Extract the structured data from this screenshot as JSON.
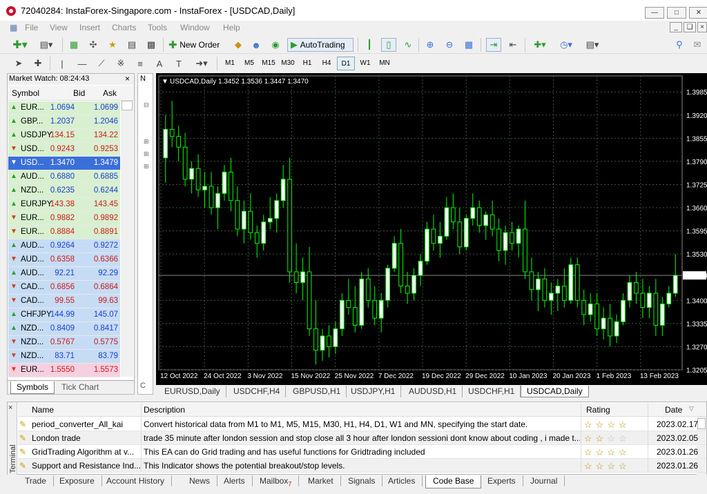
{
  "window": {
    "title": "72040284: InstaForex-Singapore.com - InstaForex - [USDCAD,Daily]"
  },
  "menu": [
    "File",
    "View",
    "Insert",
    "Charts",
    "Tools",
    "Window",
    "Help"
  ],
  "toolbar": {
    "new_order": "New Order",
    "autotrading": "AutoTrading"
  },
  "timeframes": [
    "M1",
    "M5",
    "M15",
    "M30",
    "H1",
    "H4",
    "D1",
    "W1",
    "MN"
  ],
  "active_timeframe": "D1",
  "market_watch": {
    "header": "Market Watch: 08:24:43",
    "cols": {
      "symbol": "Symbol",
      "bid": "Bid",
      "ask": "Ask"
    },
    "rows": [
      {
        "symbol": "EUR...",
        "bid": "1.0694",
        "ask": "1.0699",
        "dir": "up",
        "bg": "#d8f0d0",
        "red": false
      },
      {
        "symbol": "GBP...",
        "bid": "1.2037",
        "ask": "1.2046",
        "dir": "up",
        "bg": "#d8f0d0",
        "red": false
      },
      {
        "symbol": "USDJPY",
        "bid": "134.15",
        "ask": "134.22",
        "dir": "up",
        "bg": "#d8f0d0",
        "red": true
      },
      {
        "symbol": "USD...",
        "bid": "0.9243",
        "ask": "0.9253",
        "dir": "down",
        "bg": "#d8f0d0",
        "red": true
      },
      {
        "symbol": "USD...",
        "bid": "1.3470",
        "ask": "1.3479",
        "dir": "down",
        "bg": "#3a6fd8",
        "red": false,
        "sel": true
      },
      {
        "symbol": "AUD...",
        "bid": "0.6880",
        "ask": "0.6885",
        "dir": "up",
        "bg": "#d8f0d0",
        "red": false
      },
      {
        "symbol": "NZD...",
        "bid": "0.6235",
        "ask": "0.6244",
        "dir": "up",
        "bg": "#d8f0d0",
        "red": false
      },
      {
        "symbol": "EURJPY",
        "bid": "143.38",
        "ask": "143.45",
        "dir": "up",
        "bg": "#d8f0d0",
        "red": true
      },
      {
        "symbol": "EUR...",
        "bid": "0.9882",
        "ask": "0.9892",
        "dir": "down",
        "bg": "#d8f0d0",
        "red": true
      },
      {
        "symbol": "EUR...",
        "bid": "0.8884",
        "ask": "0.8891",
        "dir": "down",
        "bg": "#d8f0d0",
        "red": true
      },
      {
        "symbol": "AUD...",
        "bid": "0.9264",
        "ask": "0.9272",
        "dir": "up",
        "bg": "#c6dcf5",
        "red": false
      },
      {
        "symbol": "AUD...",
        "bid": "0.6358",
        "ask": "0.6366",
        "dir": "down",
        "bg": "#c6dcf5",
        "red": true
      },
      {
        "symbol": "AUD...",
        "bid": "92.21",
        "ask": "92.29",
        "dir": "up",
        "bg": "#c6dcf5",
        "red": false
      },
      {
        "symbol": "CAD...",
        "bid": "0.6856",
        "ask": "0.6864",
        "dir": "down",
        "bg": "#c6dcf5",
        "red": true
      },
      {
        "symbol": "CAD...",
        "bid": "99.55",
        "ask": "99.63",
        "dir": "down",
        "bg": "#c6dcf5",
        "red": true
      },
      {
        "symbol": "CHFJPY",
        "bid": "144.99",
        "ask": "145.07",
        "dir": "up",
        "bg": "#c6dcf5",
        "red": false
      },
      {
        "symbol": "NZD...",
        "bid": "0.8409",
        "ask": "0.8417",
        "dir": "up",
        "bg": "#c6dcf5",
        "red": false
      },
      {
        "symbol": "NZD...",
        "bid": "0.5767",
        "ask": "0.5775",
        "dir": "down",
        "bg": "#c6dcf5",
        "red": true
      },
      {
        "symbol": "NZD...",
        "bid": "83.71",
        "ask": "83.79",
        "dir": "down",
        "bg": "#c6dcf5",
        "red": false
      },
      {
        "symbol": "EUR...",
        "bid": "1.5550",
        "ask": "1.5573",
        "dir": "down",
        "bg": "#f5d0e0",
        "red": true
      }
    ],
    "tabs": [
      "Symbols",
      "Tick Chart"
    ]
  },
  "nav_label": "N",
  "chart": {
    "header": "USDCAD,Daily  1.3452 1.3536 1.3447 1.3470",
    "current_price": "1.3470",
    "price_labels": [
      "1.3985",
      "1.3920",
      "1.3855",
      "1.3790",
      "1.3725",
      "1.3660",
      "1.3595",
      "1.3530",
      "1.3470",
      "1.3400",
      "1.3335",
      "1.3270",
      "1.3205"
    ],
    "date_labels": [
      "12 Oct 2022",
      "24 Oct 2022",
      "3 Nov 2022",
      "15 Nov 2022",
      "25 Nov 2022",
      "7 Dec 2022",
      "19 Dec 2022",
      "29 Dec 2022",
      "10 Jan 2023",
      "20 Jan 2023",
      "1 Feb 2023",
      "13 Feb 2023"
    ],
    "y_range": [
      1.3205,
      1.403
    ],
    "bull_color": "#ffffff",
    "bear_color": "#000000",
    "wick_color": "#00ff00",
    "grid_color": "#3a5a3a"
  },
  "chart_data": {
    "type": "candlestick",
    "symbol": "USDCAD",
    "timeframe": "Daily",
    "ohlc": [
      [
        1.38,
        1.392,
        1.373,
        1.388
      ],
      [
        1.388,
        1.396,
        1.383,
        1.386
      ],
      [
        1.386,
        1.389,
        1.379,
        1.383
      ],
      [
        1.383,
        1.387,
        1.372,
        1.374
      ],
      [
        1.374,
        1.379,
        1.37,
        1.377
      ],
      [
        1.377,
        1.381,
        1.369,
        1.371
      ],
      [
        1.371,
        1.376,
        1.366,
        1.372
      ],
      [
        1.372,
        1.376,
        1.364,
        1.366
      ],
      [
        1.366,
        1.372,
        1.36,
        1.37
      ],
      [
        1.37,
        1.378,
        1.368,
        1.376
      ],
      [
        1.376,
        1.38,
        1.365,
        1.368
      ],
      [
        1.368,
        1.372,
        1.358,
        1.36
      ],
      [
        1.36,
        1.368,
        1.356,
        1.365
      ],
      [
        1.365,
        1.37,
        1.357,
        1.359
      ],
      [
        1.359,
        1.361,
        1.352,
        1.356
      ],
      [
        1.356,
        1.364,
        1.354,
        1.362
      ],
      [
        1.362,
        1.369,
        1.36,
        1.363
      ],
      [
        1.363,
        1.37,
        1.359,
        1.368
      ],
      [
        1.368,
        1.378,
        1.366,
        1.374
      ],
      [
        1.374,
        1.38,
        1.345,
        1.348
      ],
      [
        1.348,
        1.356,
        1.342,
        1.345
      ],
      [
        1.345,
        1.352,
        1.34,
        1.348
      ],
      [
        1.348,
        1.355,
        1.33,
        1.332
      ],
      [
        1.332,
        1.34,
        1.322,
        1.326
      ],
      [
        1.326,
        1.332,
        1.323,
        1.33
      ],
      [
        1.33,
        1.333,
        1.324,
        1.327
      ],
      [
        1.327,
        1.334,
        1.325,
        1.332
      ],
      [
        1.332,
        1.342,
        1.33,
        1.34
      ],
      [
        1.34,
        1.346,
        1.336,
        1.338
      ],
      [
        1.338,
        1.344,
        1.331,
        1.333
      ],
      [
        1.333,
        1.348,
        1.332,
        1.346
      ],
      [
        1.346,
        1.349,
        1.338,
        1.34
      ],
      [
        1.34,
        1.344,
        1.333,
        1.335
      ],
      [
        1.335,
        1.342,
        1.331,
        1.34
      ],
      [
        1.34,
        1.35,
        1.338,
        1.349
      ],
      [
        1.349,
        1.358,
        1.348,
        1.356
      ],
      [
        1.356,
        1.36,
        1.342,
        1.344
      ],
      [
        1.344,
        1.348,
        1.339,
        1.342
      ],
      [
        1.342,
        1.349,
        1.34,
        1.347
      ],
      [
        1.347,
        1.353,
        1.344,
        1.351
      ],
      [
        1.351,
        1.362,
        1.35,
        1.36
      ],
      [
        1.36,
        1.364,
        1.354,
        1.356
      ],
      [
        1.356,
        1.362,
        1.352,
        1.358
      ],
      [
        1.358,
        1.369,
        1.357,
        1.366
      ],
      [
        1.366,
        1.37,
        1.36,
        1.362
      ],
      [
        1.362,
        1.366,
        1.353,
        1.355
      ],
      [
        1.355,
        1.364,
        1.354,
        1.363
      ],
      [
        1.363,
        1.37,
        1.361,
        1.366
      ],
      [
        1.366,
        1.368,
        1.359,
        1.361
      ],
      [
        1.361,
        1.365,
        1.357,
        1.364
      ],
      [
        1.364,
        1.368,
        1.358,
        1.36
      ],
      [
        1.36,
        1.363,
        1.351,
        1.354
      ],
      [
        1.354,
        1.361,
        1.35,
        1.359
      ],
      [
        1.359,
        1.362,
        1.354,
        1.356
      ],
      [
        1.356,
        1.361,
        1.352,
        1.36
      ],
      [
        1.36,
        1.368,
        1.346,
        1.348
      ],
      [
        1.348,
        1.352,
        1.34,
        1.343
      ],
      [
        1.343,
        1.348,
        1.337,
        1.346
      ],
      [
        1.346,
        1.349,
        1.338,
        1.34
      ],
      [
        1.34,
        1.345,
        1.336,
        1.342
      ],
      [
        1.342,
        1.346,
        1.337,
        1.344
      ],
      [
        1.344,
        1.349,
        1.338,
        1.34
      ],
      [
        1.34,
        1.352,
        1.339,
        1.35
      ],
      [
        1.35,
        1.352,
        1.338,
        1.34
      ],
      [
        1.34,
        1.343,
        1.333,
        1.336
      ],
      [
        1.336,
        1.342,
        1.334,
        1.339
      ],
      [
        1.339,
        1.342,
        1.33,
        1.332
      ],
      [
        1.332,
        1.338,
        1.329,
        1.335
      ],
      [
        1.335,
        1.339,
        1.327,
        1.33
      ],
      [
        1.33,
        1.336,
        1.328,
        1.334
      ],
      [
        1.334,
        1.342,
        1.333,
        1.34
      ],
      [
        1.34,
        1.347,
        1.338,
        1.345
      ],
      [
        1.345,
        1.348,
        1.339,
        1.342
      ],
      [
        1.342,
        1.346,
        1.335,
        1.338
      ],
      [
        1.338,
        1.344,
        1.335,
        1.342
      ],
      [
        1.342,
        1.346,
        1.33,
        1.333
      ],
      [
        1.333,
        1.341,
        1.33,
        1.339
      ],
      [
        1.339,
        1.344,
        1.338,
        1.342
      ],
      [
        1.342,
        1.353,
        1.341,
        1.347
      ]
    ]
  },
  "chart_tabs": [
    "EURUSD,Daily",
    "USDCHF,H4",
    "GBPUSD,H1",
    "USDJPY,H1",
    "AUDUSD,H1",
    "USDCHF,H1",
    "USDCAD,Daily"
  ],
  "terminal": {
    "side_label": "Terminal",
    "cols": {
      "name": "Name",
      "description": "Description",
      "rating": "Rating",
      "date": "Date"
    },
    "rows": [
      {
        "name": "period_converter_All_kai",
        "desc": "Convert historical data from M1 to M1, M5, M15, M30, H1, H4, D1, W1 and MN, specifying the start date.",
        "rating": 4,
        "date": "2023.02.17"
      },
      {
        "name": "London trade",
        "desc": "trade 35 minute after london session and stop close all 3 hour after london sessioni dont know about coding , i made t...",
        "rating": 2,
        "date": "2023.02.05"
      },
      {
        "name": "GridTrading Algorithm at v...",
        "desc": "This EA can do Grid trading and has useful functions for Gridtrading included",
        "rating": 4,
        "date": "2023.01.26"
      },
      {
        "name": "Support and Resistance Ind...",
        "desc": "This Indicator shows the potential breakout/stop levels.",
        "rating": 4,
        "date": "2023.01.26"
      }
    ],
    "tabs": [
      "Trade",
      "Exposure",
      "Account History",
      "News",
      "Alerts",
      "Mailbox",
      "Market",
      "Signals",
      "Articles",
      "Code Base",
      "Experts",
      "Journal"
    ],
    "mailbox_badge": "7",
    "active_tab": "Code Base"
  }
}
